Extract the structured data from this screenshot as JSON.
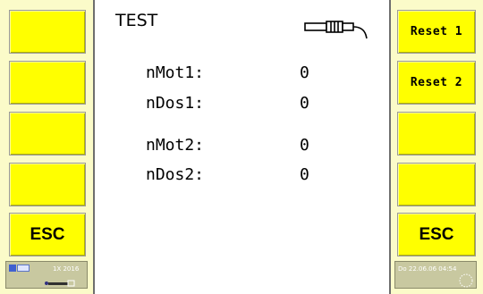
{
  "title": "TEST",
  "left_buttons": [
    "",
    "",
    "",
    "",
    "ESC"
  ],
  "right_buttons": [
    "Reset 1",
    "Reset 2",
    "",
    "",
    "ESC"
  ],
  "rows": [
    {
      "label": "nMot1:",
      "value": "0"
    },
    {
      "label": "nDos1:",
      "value": "0"
    },
    {
      "label": "nMot2:",
      "value": "0"
    },
    {
      "label": "nDos2:",
      "value": "0"
    }
  ],
  "left_status": {
    "text": "1X 2016"
  },
  "right_status": {
    "text": "Do 22.06.06 04:54"
  },
  "colors": {
    "button": "#ffff00",
    "sidebar_bg": "#fbfbc9",
    "border": "#6e6e6e"
  },
  "icons": {
    "sensor": "proximity-sensor-icon"
  }
}
